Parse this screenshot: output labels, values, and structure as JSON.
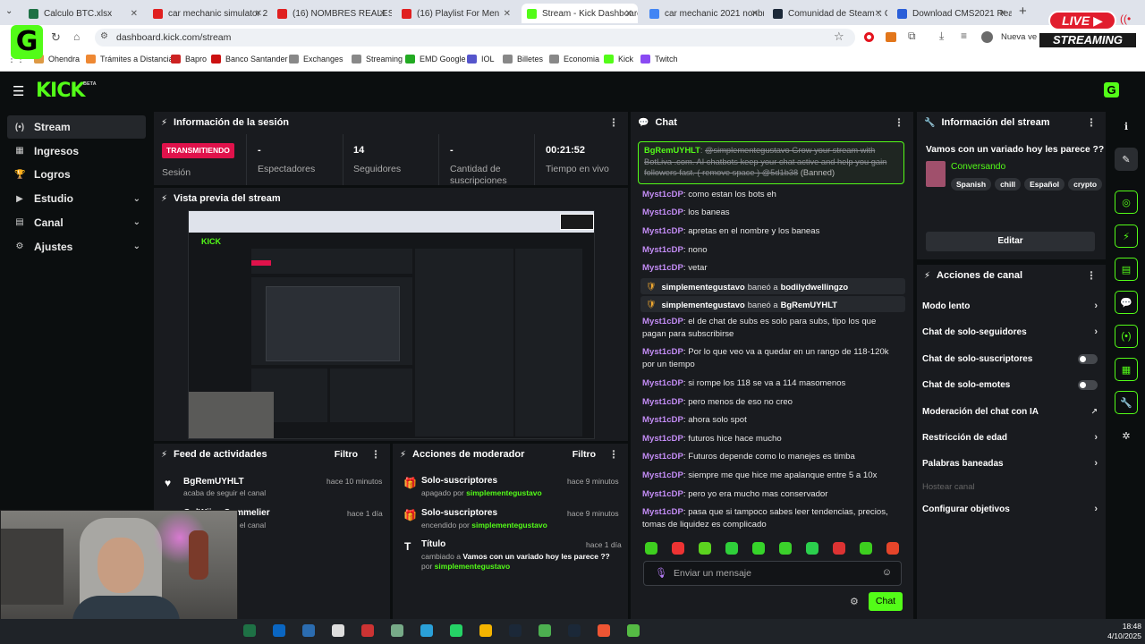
{
  "browser": {
    "tabs": [
      {
        "title": "Calculo BTC.xlsx",
        "color": "#1e7145"
      },
      {
        "title": "car mechanic simulator 2C",
        "color": "#e02020"
      },
      {
        "title": "(16) NOMBRES REALES DE",
        "color": "#e02020"
      },
      {
        "title": "(16) Playlist For Men",
        "color": "#e02020"
      },
      {
        "title": "Stream - Kick Dashboard",
        "color": "#53fc18"
      },
      {
        "title": "car mechanic 2021 nonbr",
        "color": "#4285f4"
      },
      {
        "title": "Comunidad de Steam :: G",
        "color": "#1b2838"
      },
      {
        "title": "Download CMS2021 Real",
        "color": "#2b5fd9"
      }
    ],
    "url": "dashboard.kick.com/stream",
    "profile_label": "Nueva ve",
    "bookmarks": [
      "Ohendra",
      "Trámites a Distancia",
      "Bapro",
      "Banco Santander",
      "Exchanges",
      "Streaming",
      "EMD Google",
      "IOL",
      "Billetes",
      "Economia",
      "Kick",
      "Twitch"
    ]
  },
  "overlay": {
    "live": "LIVE",
    "streaming": "STREAMING",
    "badge_letter": "G"
  },
  "kick": {
    "logo": "KICK",
    "logo_beta": "BETA",
    "avatar_letter": "G",
    "sidebar": [
      {
        "label": "Stream",
        "icon": "(•)",
        "active": true,
        "chevron": false
      },
      {
        "label": "Ingresos",
        "icon": "▦",
        "active": false,
        "chevron": false
      },
      {
        "label": "Logros",
        "icon": "🏆",
        "active": false,
        "chevron": false
      },
      {
        "label": "Estudio",
        "icon": "▶",
        "active": false,
        "chevron": true
      },
      {
        "label": "Canal",
        "icon": "▤",
        "active": false,
        "chevron": true
      },
      {
        "label": "Ajustes",
        "icon": "⚙",
        "active": false,
        "chevron": true
      }
    ],
    "session": {
      "title": "Información de la sesión",
      "status_badge": "TRANSMITIENDO",
      "session_label": "Sesión",
      "stats": [
        {
          "value": "-",
          "label": "Espectadores"
        },
        {
          "value": "14",
          "label": "Seguidores"
        },
        {
          "value": "-",
          "label": "Cantidad de suscripciones"
        },
        {
          "value": "00:21:52",
          "label": "Tiempo en vivo"
        }
      ]
    },
    "preview": {
      "title": "Vista previa del stream"
    },
    "activity": {
      "title": "Feed de actividades",
      "filter": "Filtro",
      "items": [
        {
          "user": "BgRemUYHLT",
          "text": "acaba de seguir el canal",
          "time": "hace 10 minutos"
        },
        {
          "user": "GolWiiva Sommelier",
          "text": "acaba de seguir el canal",
          "time": "hace 1 día"
        }
      ]
    },
    "modactions": {
      "title": "Acciones de moderador",
      "filter": "Filtro",
      "items": [
        {
          "title": "Solo-suscriptores",
          "prefix": "apagado por",
          "user": "simplementegustavo",
          "time": "hace 9 minutos"
        },
        {
          "title": "Solo-suscriptores",
          "prefix": "encendido por",
          "user": "simplementegustavo",
          "time": "hace 9 minutos"
        },
        {
          "title": "Título",
          "prefix": "cambiado a",
          "value": "Vamos con un variado hoy les parece ??",
          "suffix": "por",
          "user": "simplementegustavo",
          "time": "hace 1 día"
        }
      ]
    },
    "chat": {
      "title": "Chat",
      "pinned_user": "BgRemUYHLT",
      "pinned_text": "@simplementegustavo Grow your stream with BotLiva .com. AI chatbots keep your chat active and help you gain followers fast. ( remove space ) @5d1b38",
      "pinned_tag": "(Banned)",
      "messages": [
        {
          "user": "Myst1cDP",
          "text": "como estan los bots eh"
        },
        {
          "user": "Myst1cDP",
          "text": "los baneas"
        },
        {
          "user": "Myst1cDP",
          "text": "apretas en el nombre y los baneas"
        },
        {
          "user": "Myst1cDP",
          "text": "nono"
        },
        {
          "user": "Myst1cDP",
          "text": "vetar"
        }
      ],
      "bans": [
        {
          "mod": "simplementegustavo",
          "verb": "baneó a",
          "target": "bodilydwellingzo"
        },
        {
          "mod": "simplementegustavo",
          "verb": "baneó a",
          "target": "BgRemUYHLT"
        }
      ],
      "messages2": [
        {
          "user": "Myst1cDP",
          "text": "el de chat de subs es solo para subs, tipo los que pagan para subscribirse"
        },
        {
          "user": "Myst1cDP",
          "text": "Por lo que veo va a quedar en un rango de 118-120k por un tiempo"
        },
        {
          "user": "Myst1cDP",
          "text": "si rompe los 118 se va a 114 masomenos"
        },
        {
          "user": "Myst1cDP",
          "text": "pero menos de eso no creo"
        },
        {
          "user": "Myst1cDP",
          "text": "ahora solo spot"
        },
        {
          "user": "Myst1cDP",
          "text": "futuros hice hace mucho"
        },
        {
          "user": "Myst1cDP",
          "text": "Futuros depende como lo manejes es timba"
        },
        {
          "user": "Myst1cDP",
          "text": "siempre me que hice me apalanque entre 5 a 10x"
        },
        {
          "user": "Myst1cDP",
          "text": "pero yo era mucho mas conservador"
        },
        {
          "user": "Myst1cDP",
          "text": "pasa que si tampoco sabes leer tendencias, precios, tomas de liquidez es complicado"
        }
      ],
      "input_placeholder": "Enviar un mensaje",
      "send_label": "Chat"
    },
    "stream_info": {
      "title": "Información del stream",
      "stream_title": "Vamos con un variado hoy les parece ??",
      "category": "Conversando",
      "tags": [
        "Spanish",
        "chill",
        "Español",
        "crypto"
      ],
      "edit_label": "Editar"
    },
    "channel_actions": {
      "title": "Acciones de canal",
      "items": [
        {
          "label": "Modo lento",
          "control": "chevron"
        },
        {
          "label": "Chat de solo-seguidores",
          "control": "chevron"
        },
        {
          "label": "Chat de solo-suscriptores",
          "control": "toggle"
        },
        {
          "label": "Chat de solo-emotes",
          "control": "toggle"
        },
        {
          "label": "Moderación del chat con IA",
          "control": "external"
        },
        {
          "label": "Restricción de edad",
          "control": "chevron"
        },
        {
          "label": "Palabras baneadas",
          "control": "chevron"
        },
        {
          "label": "Hostear canal",
          "control": "none",
          "disabled": true
        },
        {
          "label": "Configurar objetivos",
          "control": "chevron"
        }
      ]
    }
  },
  "taskbar": {
    "time": "18:48",
    "date": "4/10/2025"
  }
}
